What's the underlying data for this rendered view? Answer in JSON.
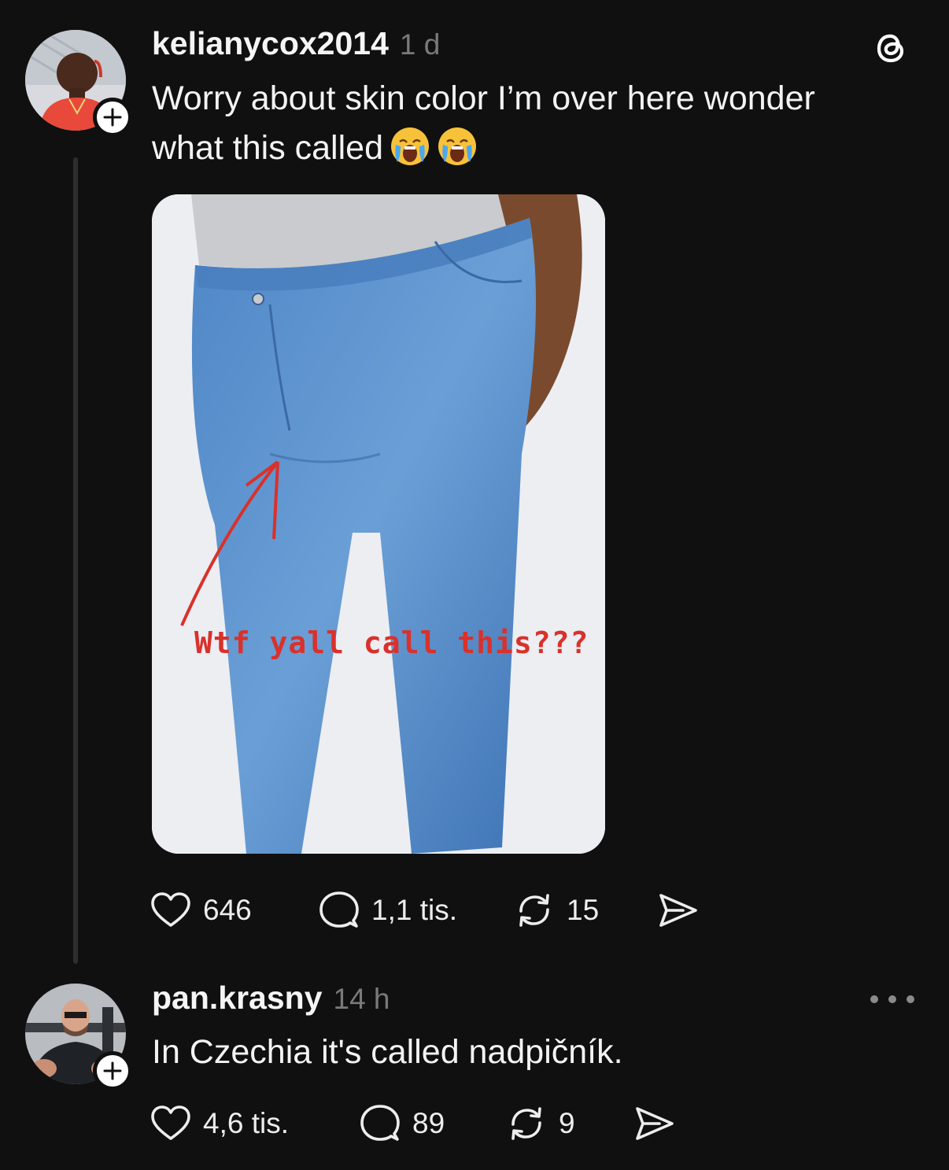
{
  "post": {
    "username": "kelianycox2014",
    "timestamp": "1 d",
    "text_line1": "Worry about skin color I’m over here wonder",
    "text_line2": "what this called",
    "emoji": "loudly-crying-face",
    "image_caption": "Wtf yall call this???",
    "likes": "646",
    "replies": "1,1 tis.",
    "reposts": "15"
  },
  "reply": {
    "username": "pan.krasny",
    "timestamp": "14 h",
    "text": "In Czechia it's called nadpičník.",
    "likes": "4,6 tis.",
    "replies": "89",
    "reposts": "9"
  },
  "icons": {
    "app_logo": "threads-logo-icon",
    "like": "heart-icon",
    "reply": "speech-bubble-icon",
    "repost": "repost-icon",
    "share": "send-icon",
    "follow": "plus-icon",
    "more": "ellipsis-icon"
  },
  "colors": {
    "background": "#101010",
    "text_primary": "#f3f3f3",
    "text_secondary": "#7a7a7a",
    "caption_red": "#d9312b"
  }
}
